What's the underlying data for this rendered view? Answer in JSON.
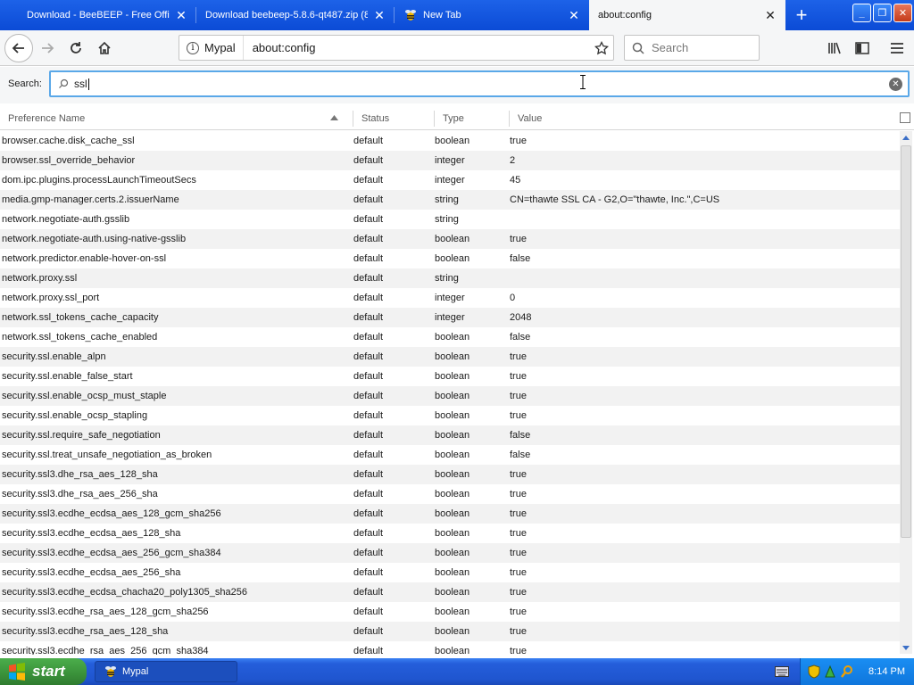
{
  "tabs": [
    {
      "title": "Download - BeeBEEP - Free Office",
      "active": false
    },
    {
      "title": "Download beebeep-5.8.6-qt487.zip (8",
      "active": false
    },
    {
      "title": "New Tab",
      "active": false
    },
    {
      "title": "about:config",
      "active": true
    }
  ],
  "urlbar": {
    "identity": "Mypal",
    "url": "about:config"
  },
  "searchbar": {
    "placeholder": "Search"
  },
  "config": {
    "search_label": "Search:",
    "search_value": "ssl",
    "columns": [
      "Preference Name",
      "Status",
      "Type",
      "Value"
    ],
    "rows": [
      [
        "browser.cache.disk_cache_ssl",
        "default",
        "boolean",
        "true"
      ],
      [
        "browser.ssl_override_behavior",
        "default",
        "integer",
        "2"
      ],
      [
        "dom.ipc.plugins.processLaunchTimeoutSecs",
        "default",
        "integer",
        "45"
      ],
      [
        "media.gmp-manager.certs.2.issuerName",
        "default",
        "string",
        "CN=thawte SSL CA - G2,O=\"thawte, Inc.\",C=US"
      ],
      [
        "network.negotiate-auth.gsslib",
        "default",
        "string",
        ""
      ],
      [
        "network.negotiate-auth.using-native-gsslib",
        "default",
        "boolean",
        "true"
      ],
      [
        "network.predictor.enable-hover-on-ssl",
        "default",
        "boolean",
        "false"
      ],
      [
        "network.proxy.ssl",
        "default",
        "string",
        ""
      ],
      [
        "network.proxy.ssl_port",
        "default",
        "integer",
        "0"
      ],
      [
        "network.ssl_tokens_cache_capacity",
        "default",
        "integer",
        "2048"
      ],
      [
        "network.ssl_tokens_cache_enabled",
        "default",
        "boolean",
        "false"
      ],
      [
        "security.ssl.enable_alpn",
        "default",
        "boolean",
        "true"
      ],
      [
        "security.ssl.enable_false_start",
        "default",
        "boolean",
        "true"
      ],
      [
        "security.ssl.enable_ocsp_must_staple",
        "default",
        "boolean",
        "true"
      ],
      [
        "security.ssl.enable_ocsp_stapling",
        "default",
        "boolean",
        "true"
      ],
      [
        "security.ssl.require_safe_negotiation",
        "default",
        "boolean",
        "false"
      ],
      [
        "security.ssl.treat_unsafe_negotiation_as_broken",
        "default",
        "boolean",
        "false"
      ],
      [
        "security.ssl3.dhe_rsa_aes_128_sha",
        "default",
        "boolean",
        "true"
      ],
      [
        "security.ssl3.dhe_rsa_aes_256_sha",
        "default",
        "boolean",
        "true"
      ],
      [
        "security.ssl3.ecdhe_ecdsa_aes_128_gcm_sha256",
        "default",
        "boolean",
        "true"
      ],
      [
        "security.ssl3.ecdhe_ecdsa_aes_128_sha",
        "default",
        "boolean",
        "true"
      ],
      [
        "security.ssl3.ecdhe_ecdsa_aes_256_gcm_sha384",
        "default",
        "boolean",
        "true"
      ],
      [
        "security.ssl3.ecdhe_ecdsa_aes_256_sha",
        "default",
        "boolean",
        "true"
      ],
      [
        "security.ssl3.ecdhe_ecdsa_chacha20_poly1305_sha256",
        "default",
        "boolean",
        "true"
      ],
      [
        "security.ssl3.ecdhe_rsa_aes_128_gcm_sha256",
        "default",
        "boolean",
        "true"
      ],
      [
        "security.ssl3.ecdhe_rsa_aes_128_sha",
        "default",
        "boolean",
        "true"
      ],
      [
        "security.ssl3.ecdhe_rsa_aes_256_gcm_sha384",
        "default",
        "boolean",
        "true"
      ]
    ]
  },
  "taskbar": {
    "start_label": "start",
    "task_item": "Mypal",
    "clock": "8:14 PM"
  },
  "colors": {
    "tabbar": "#0b4bd6",
    "search_focus": "#5aa8e8",
    "start_green": "#3a913a",
    "tray_blue": "#0f76dc"
  }
}
